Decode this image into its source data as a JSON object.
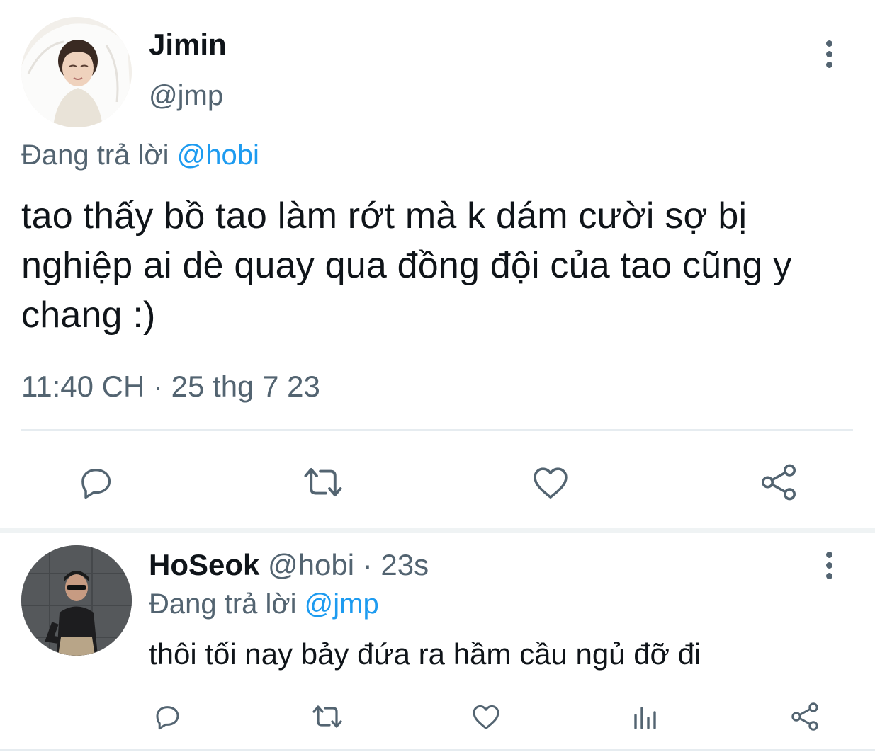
{
  "main_tweet": {
    "author_name": "Jimin",
    "author_handle": "@jmp",
    "replying_label": "Đang trả lời ",
    "replying_to": "@hobi",
    "text": "tao thấy bồ tao làm rớt mà k dám cười sợ bị nghiệp ai dè quay qua đồng đội của tao cũng y chang :)",
    "timestamp": "11:40 CH · 25 thg 7 23",
    "avatar_icon": "profile-photo-jimin"
  },
  "reply_tweet": {
    "author_name": "HoSeok",
    "author_handle": "@hobi",
    "separator": " · ",
    "time_ago": "23s",
    "replying_label": "Đang trả lời ",
    "replying_to": "@jmp",
    "text": "thôi tối nay bảy đứa ra hầm cầu ngủ đỡ đi",
    "avatar_icon": "profile-photo-hoseok"
  },
  "actions": {
    "icons": [
      "reply-icon",
      "retweet-icon",
      "like-icon",
      "views-icon",
      "share-icon"
    ]
  },
  "colors": {
    "text_primary": "#0f1419",
    "text_secondary": "#536471",
    "accent": "#1d9bf0",
    "divider": "#e6ecf0"
  }
}
